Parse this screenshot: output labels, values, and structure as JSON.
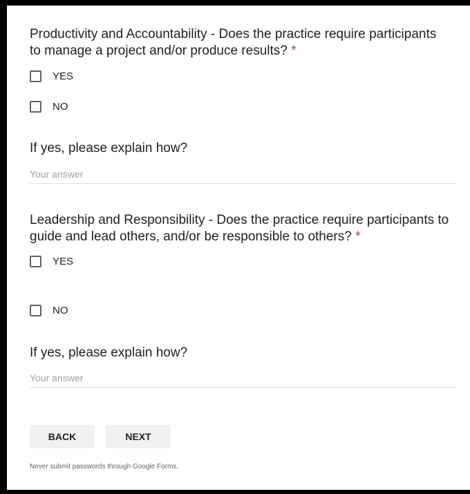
{
  "questions": [
    {
      "title": "Productivity and Accountability - Does the practice require participants to manage a project and/or produce results?",
      "required_mark": "*",
      "options": [
        "YES",
        "NO"
      ]
    },
    {
      "title": "If yes, please explain how?",
      "placeholder": "Your answer"
    },
    {
      "title": "Leadership and Responsibility - Does the practice require participants to guide and lead others, and/or be responsible to others?",
      "required_mark": "*",
      "options": [
        "YES",
        "NO"
      ]
    },
    {
      "title": "If yes, please explain how?",
      "placeholder": "Your answer"
    }
  ],
  "nav": {
    "back_label": "BACK",
    "next_label": "NEXT"
  },
  "footer": {
    "notice": "Never submit passwords through Google Forms."
  },
  "colors": {
    "required": "#d93025",
    "button_bg": "#f1f1f1",
    "divider": "#dadce0"
  }
}
